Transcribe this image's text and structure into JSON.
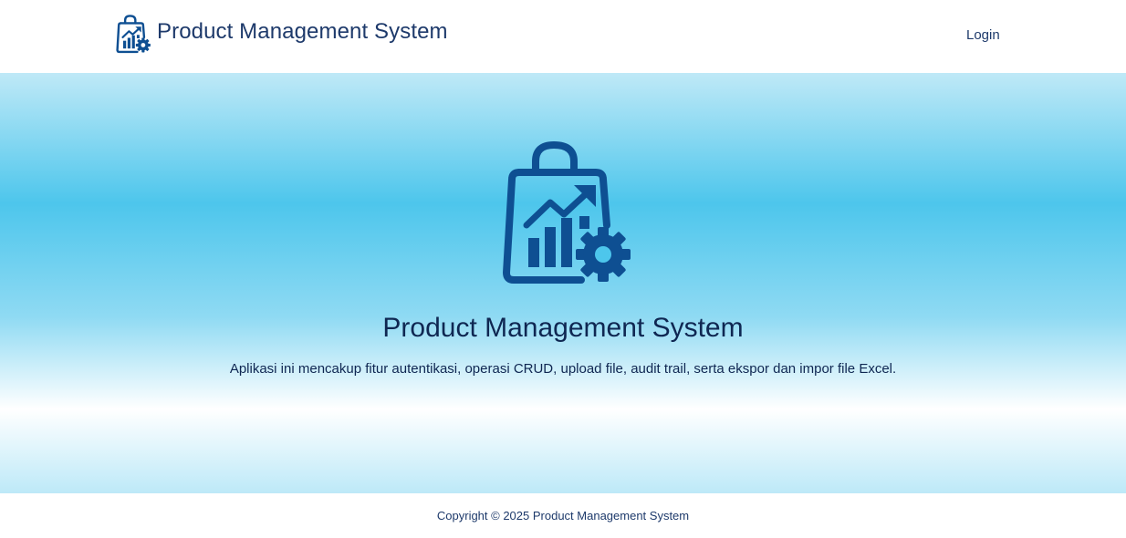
{
  "navbar": {
    "brand_text": "Product Management System",
    "brand_icon": "shopping-bag-chart-gear-icon",
    "login_label": "Login"
  },
  "hero": {
    "icon": "shopping-bag-chart-gear-icon",
    "title": "Product Management System",
    "description": "Aplikasi ini mencakup fitur autentikasi, operasi CRUD, upload file, audit trail, serta ekspor dan impor file Excel."
  },
  "footer": {
    "copyright": "Copyright © 2025 Product Management System"
  },
  "colors": {
    "brand_blue": "#0e4f92",
    "text_dark": "#0f2752",
    "hero_cyan": "#4dc6ec"
  }
}
